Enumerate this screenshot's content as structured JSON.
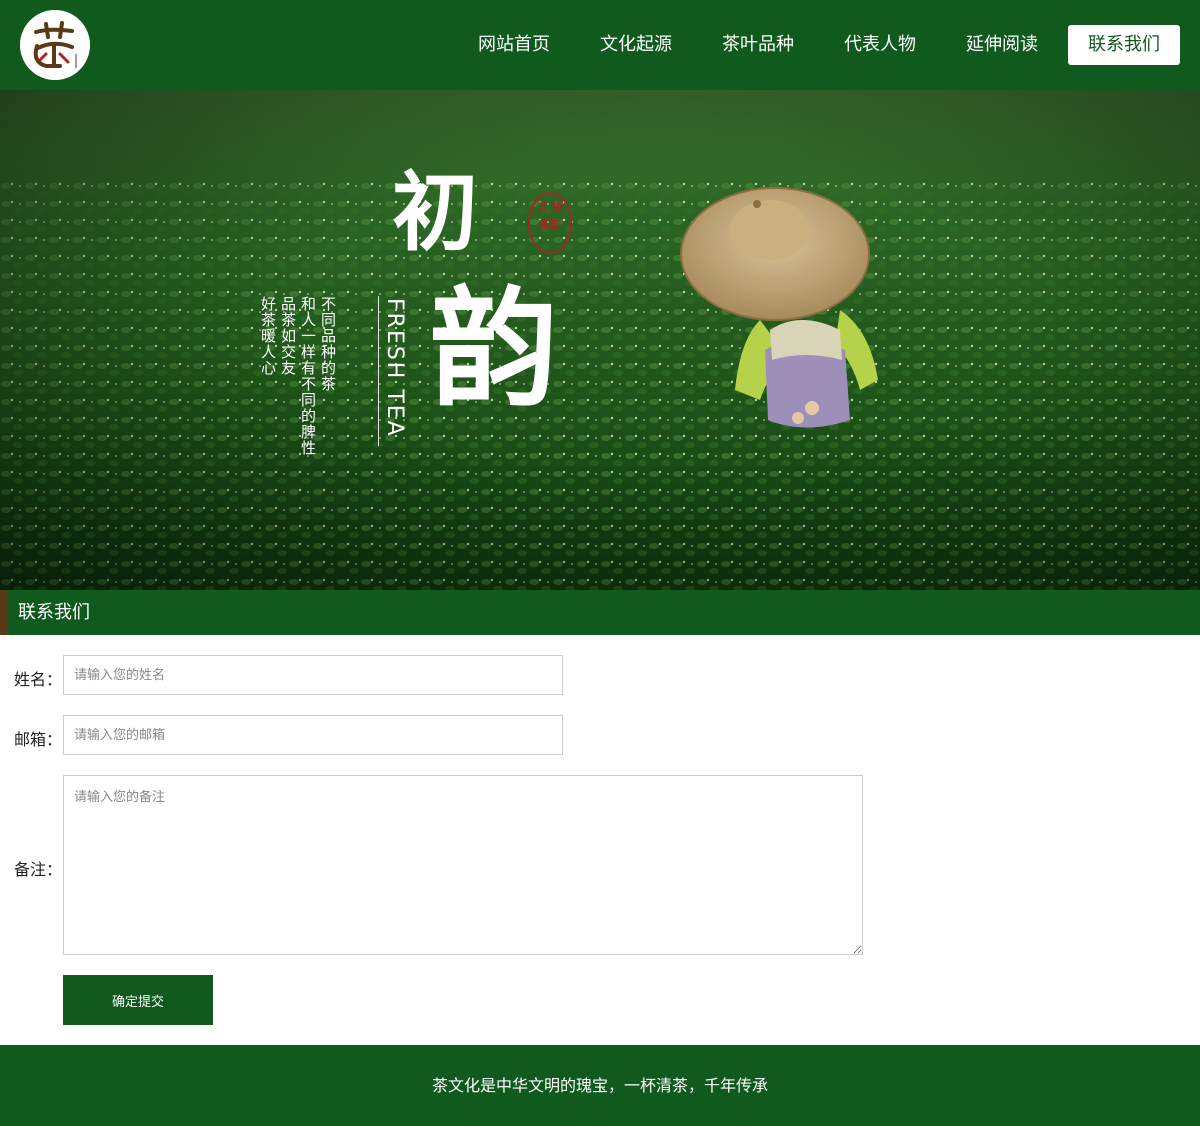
{
  "header": {
    "logo_text": "茶",
    "nav": [
      {
        "label": "网站首页"
      },
      {
        "label": "文化起源"
      },
      {
        "label": "茶叶品种"
      },
      {
        "label": "代表人物"
      },
      {
        "label": "延伸阅读"
      },
      {
        "label": "联系我们",
        "active": true
      }
    ]
  },
  "banner": {
    "big_char_1": "初",
    "big_char_2": "韵",
    "english": "FRESH TEA",
    "poem": [
      "不同品种的茶",
      "和人一样有不同的脾性",
      "品茶如交友",
      "好茶暖人心"
    ],
    "seal_text": "云 缘 茶韵"
  },
  "section": {
    "title": "联系我们"
  },
  "form": {
    "name_label": "姓名：",
    "name_placeholder": "请输入您的姓名",
    "email_label": "邮箱：",
    "email_placeholder": "请输入您的邮箱",
    "note_label": "备注：",
    "note_placeholder": "请输入您的备注",
    "submit_label": "确定提交"
  },
  "footer": {
    "text": "茶文化是中华文明的瑰宝，一杯清茶，千年传承"
  },
  "colors": {
    "primary_green": "#0f5a1c",
    "accent_brown": "#5a3a14",
    "seal_red": "#9c2b22"
  }
}
